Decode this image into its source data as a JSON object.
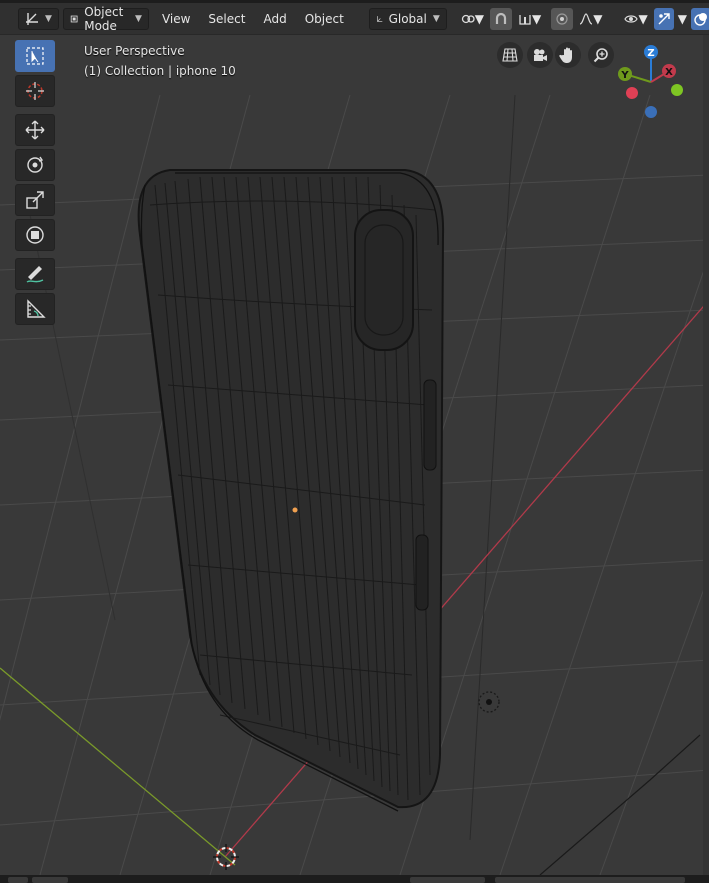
{
  "header": {
    "editor_icon": "axis-grid-icon",
    "mode_label": "Object Mode",
    "menus": [
      "View",
      "Select",
      "Add",
      "Object"
    ],
    "orientation_label": "Global",
    "pivot_icon": "link-icon",
    "snap_icon": "magnet-icon",
    "proportional_icon": "falloff-icon",
    "visibility_icon": "eye-icon",
    "gizmo_icon": "gizmo-icon",
    "overlay_icon": "overlay-icon"
  },
  "viewport": {
    "perspective_label": "User Perspective",
    "collection_label": "(1) Collection | iphone 10",
    "colors": {
      "background": "#393939",
      "grid": "#4a4a4a",
      "x_axis": "#b03a4a",
      "y_axis": "#7a9a2a",
      "wire": "#1c1c1c",
      "origin": "#f0a050"
    }
  },
  "toolbar": {
    "tools": [
      "select-box-icon",
      "cursor-icon",
      "move-icon",
      "rotate-icon",
      "scale-icon",
      "transform-icon",
      "annotate-icon",
      "measure-icon"
    ]
  },
  "navigation": {
    "buttons": [
      "grid-view-icon",
      "camera-icon",
      "hand-pan-icon",
      "zoom-icon"
    ]
  },
  "gizmo": {
    "z_label": "Z",
    "y_label": "Y",
    "x_label": "X",
    "z_color": "#2a7cd6",
    "y_color": "#6f9a1c",
    "x_color": "#c23a4c"
  }
}
